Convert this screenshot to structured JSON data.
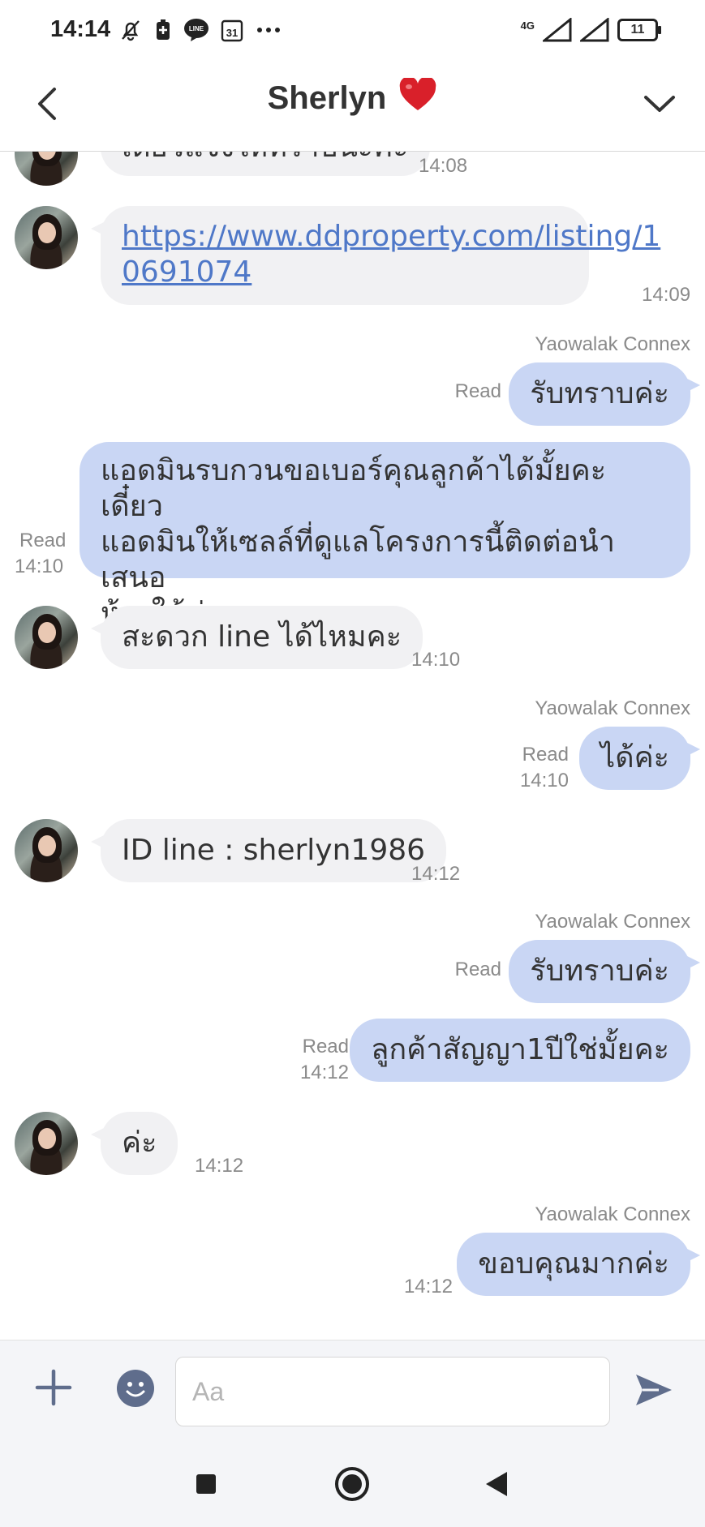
{
  "status_bar": {
    "time": "14:14",
    "network": "4G",
    "battery": "11",
    "icons": [
      "mute-bell-icon",
      "battery-saver-icon",
      "line-app-icon",
      "calendar-icon",
      "more-dots-icon"
    ]
  },
  "header": {
    "title": "Sherlyn",
    "emoji": "❤️",
    "back_icon": "chevron-left-icon",
    "expand_icon": "chevron-down-icon"
  },
  "messages": [
    {
      "id": "m0",
      "dir": "in",
      "text": "เดี๋ยวแจ้งให้ทราบนะคะ",
      "time": "14:08"
    },
    {
      "id": "m1",
      "dir": "in",
      "link": "https://www.ddproperty.com/listing/10691074",
      "line1": "https://www.ddproperty.com/listing/1",
      "line2": "0691074",
      "time": "14:09"
    },
    {
      "id": "m2",
      "dir": "out",
      "sender": "Yaowalak Connex",
      "status": "Read",
      "text": "รับทราบค่ะ"
    },
    {
      "id": "m3",
      "dir": "out",
      "status": "Read",
      "time": "14:10",
      "lines": [
        "แอดมินรบกวนขอเบอร์คุณลูกค้าได้มั้ยคะ เดี๋ยว",
        "แอดมินให้เซลล์ที่ดูแลโครงการนี้ติดต่อนำเสนอ",
        "ห้องให้ค่ะ"
      ]
    },
    {
      "id": "m4",
      "dir": "in",
      "text": "สะดวก line ได้ไหมคะ",
      "time": "14:10"
    },
    {
      "id": "m5",
      "dir": "out",
      "sender": "Yaowalak Connex",
      "status": "Read",
      "time": "14:10",
      "text": "ได้ค่ะ"
    },
    {
      "id": "m6",
      "dir": "in",
      "text": "ID line : sherlyn1986",
      "time": "14:12"
    },
    {
      "id": "m7",
      "dir": "out",
      "sender": "Yaowalak Connex",
      "status": "Read",
      "text": "รับทราบค่ะ"
    },
    {
      "id": "m8",
      "dir": "out",
      "status": "Read",
      "time": "14:12",
      "text": "ลูกค้าสัญญา1ปีใช่มั้ยคะ"
    },
    {
      "id": "m9",
      "dir": "in",
      "text": "ค่ะ",
      "time": "14:12"
    },
    {
      "id": "m10",
      "dir": "out",
      "sender": "Yaowalak Connex",
      "time": "14:12",
      "text": "ขอบคุณมากค่ะ"
    }
  ],
  "input": {
    "placeholder": "Aa"
  },
  "colors": {
    "outgoing_bubble": "#c9d6f4",
    "incoming_bubble": "#f1f1f3",
    "link": "#4f78c8",
    "heart": "#d9202a"
  }
}
